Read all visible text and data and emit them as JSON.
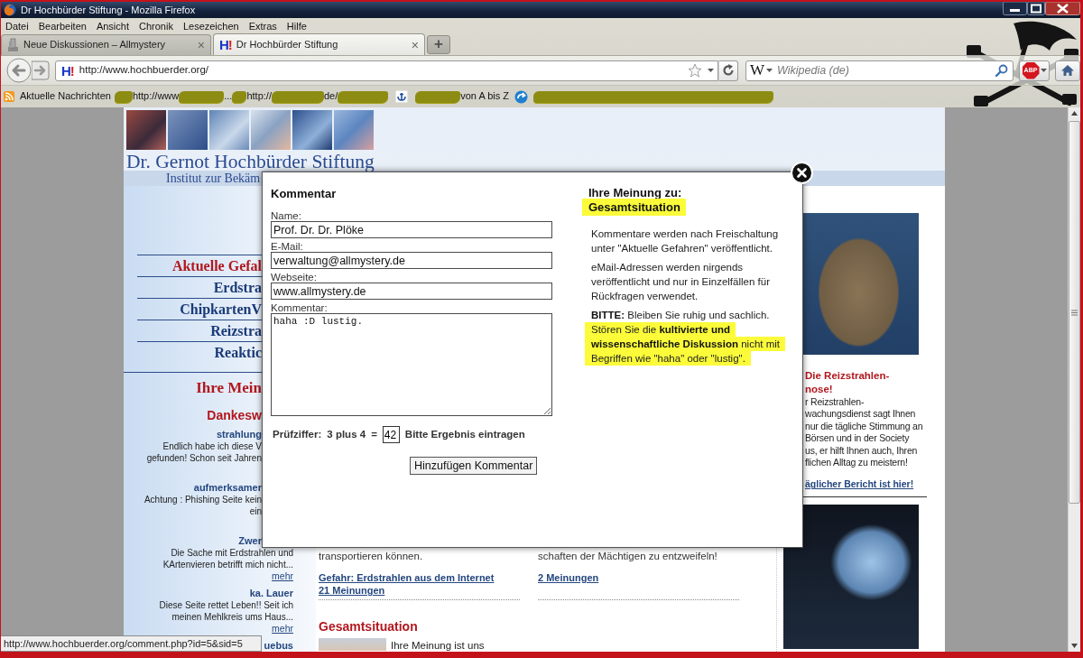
{
  "window": {
    "title": "Dr Hochbürder Stiftung - Mozilla Firefox"
  },
  "menu": [
    "Datei",
    "Bearbeiten",
    "Ansicht",
    "Chronik",
    "Lesezeichen",
    "Extras",
    "Hilfe"
  ],
  "tabs": [
    {
      "kind": "page",
      "label": "Neue Diskussionen – Allmystery",
      "close": "×",
      "selected": false
    },
    {
      "kind": "site",
      "icon_text": "H!",
      "label": "Dr Hochbürder Stiftung",
      "close": "×",
      "selected": true
    }
  ],
  "new_tab": "+",
  "address_bar": {
    "icon_text": "H!",
    "url": "http://www.hochbuerder.org/"
  },
  "search": {
    "engine": "W",
    "placeholder": "Wikipedia (de)"
  },
  "adblock": {
    "label": "ABP"
  },
  "bookmarks": [
    {
      "kind": "feed",
      "label": "Aktuelle Nachrichten"
    },
    {
      "kind": "redacted"
    },
    {
      "kind": "link",
      "label": "http://www"
    },
    {
      "kind": "redacted"
    },
    {
      "kind": "link",
      "label": "..."
    },
    {
      "kind": "redacted"
    },
    {
      "kind": "link",
      "label": "http://"
    },
    {
      "kind": "redacted"
    },
    {
      "kind": "link",
      "label": "de/"
    },
    {
      "kind": "redacted"
    },
    {
      "kind": "anchor"
    },
    {
      "kind": "redacted"
    },
    {
      "kind": "link",
      "label": "von A bis Z"
    },
    {
      "kind": "arrow-badge"
    },
    {
      "kind": "redacted"
    }
  ],
  "page": {
    "header": {
      "title": "Dr. Gernot Hochbürder Stiftung",
      "subtitle": "Institut zur Bekäm"
    },
    "nav": [
      {
        "label": "Aktuelle Gefal",
        "selected": true
      },
      {
        "label": "Erdstra",
        "selected": false
      },
      {
        "label": "ChipkartenV",
        "selected": false
      },
      {
        "label": "Reizstra",
        "selected": false
      },
      {
        "label": "Reaktic",
        "selected": false
      }
    ],
    "sidebar_heading": "Ihre Mein",
    "comments_heading": "Dankesw",
    "comments": [
      {
        "author": "strahlung",
        "lines": [
          "Endlich habe ich diese V",
          "gefunden! Schon seit Jahren"
        ]
      },
      {
        "author": "aufmerksamer",
        "lines": [
          "Achtung : Phishing Seite kein",
          "ein"
        ]
      },
      {
        "author": "Zwer",
        "lines": [
          "Die Sache mit Erdstrahlen und",
          "KArtenvieren betrifft mich nicht..."
        ],
        "more": "mehr"
      },
      {
        "author": "ka. Lauer",
        "lines": [
          "Diese Seite rettet Leben!! Seit ich",
          "meinen Mehlkreis ums Haus..."
        ],
        "more": "mehr"
      },
      {
        "author": "uebus"
      }
    ],
    "articles": [
      {
        "excerpt": "transportieren können.",
        "links": [
          "Gefahr: Erdstrahlen aus dem Internet",
          "21 Meinungen"
        ]
      },
      {
        "excerpt": "schaften der Mächtigen zu entzweifeln!",
        "links": [
          "2 Meinungen"
        ]
      }
    ],
    "section": {
      "title": "Gesamtsituation",
      "intro": "Ihre Meinung ist uns"
    },
    "right_box": {
      "title_lines": [
        "Die Reizstrahlen-",
        "nose!"
      ],
      "lines": [
        "r Reizstrahlen-",
        "wachungsdienst sagt Ihnen",
        "nur die tägliche Stimmung an",
        "Börsen und in der Society",
        "us, er hilft Ihnen auch, Ihren",
        "flichen Alltag zu meistern!"
      ],
      "link": "äglicher Bericht ist hier!"
    }
  },
  "modal": {
    "form": {
      "title": "Kommentar",
      "fields": [
        {
          "kind": "input",
          "label": "Name:",
          "value": "Prof. Dr. Dr. Plöke"
        },
        {
          "kind": "input",
          "label": "E-Mail:",
          "value": "verwaltung@allmystery.de"
        },
        {
          "kind": "input",
          "label": "Webseite:",
          "value": "www.allmystery.de"
        },
        {
          "kind": "textarea",
          "label": "Kommentar:",
          "value": "haha :D lustig."
        }
      ],
      "captcha": {
        "label": "Prüfziffer:",
        "question": "3 plus 4",
        "equals": "=",
        "value": "42",
        "hint": "Bitte Ergebnis eintragen"
      },
      "submit": "Hinzufügen Kommentar"
    },
    "info": {
      "heading": "Ihre Meinung zu:",
      "topic": {
        "text": "Gesamtsituation",
        "highlighted": true
      },
      "notes": [
        {
          "sentences": [
            {
              "text": "Kommentare werden nach Freischaltung unter \"Aktuelle Gefahren\" veröffentlicht.",
              "highlighted": false
            }
          ]
        },
        {
          "sentences": [
            {
              "text": "eMail-Adressen werden nirgends veröffentlicht und nur in Einzelfällen für Rückfragen verwendet.",
              "highlighted": false
            }
          ]
        },
        {
          "sentences": [
            {
              "text": "**BITTE:** Bleiben Sie ruhig und sachlich.",
              "highlighted": false
            },
            {
              "text": "Stören Sie die **kultivierte und wissenschaftliche Diskussion** nicht mit Begriffen wie \"haha\" oder \"lustig\".",
              "highlighted": true
            }
          ]
        }
      ]
    }
  },
  "status_bar": "http://www.hochbuerder.org/comment.php?id=5&sid=5"
}
